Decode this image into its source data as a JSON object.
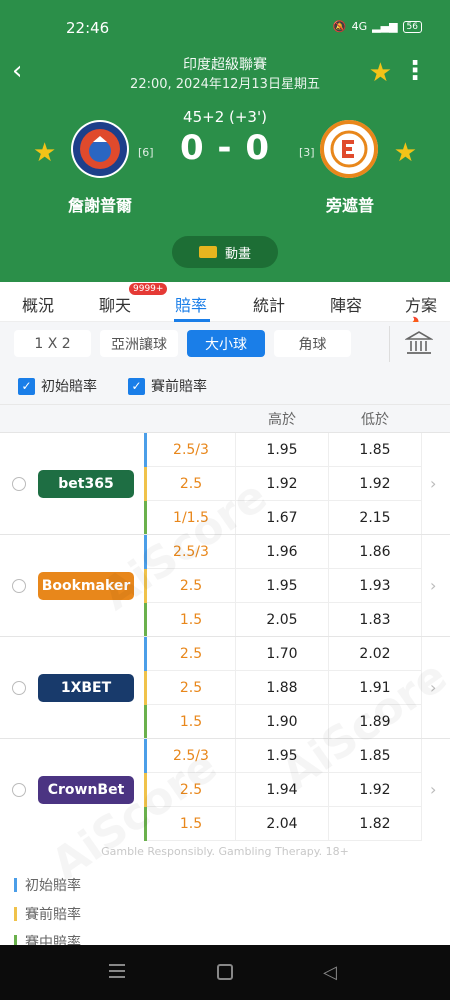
{
  "status": {
    "time": "22:46",
    "battery": "56",
    "network": "4G"
  },
  "header": {
    "league": "印度超級聯賽",
    "datetime": "22:00, 2024年12月13日星期五",
    "match_time": "45+2  (+3')",
    "score": "0 - 0",
    "home": {
      "name": "詹謝普爾",
      "rank": "[6]"
    },
    "away": {
      "name": "旁遮普",
      "rank": "[3]"
    },
    "animation_label": "動畫"
  },
  "tabs": [
    "概況",
    "聊天",
    "賠率",
    "統計",
    "陣容",
    "方案"
  ],
  "chat_badge": "9999+",
  "markets": [
    "1 X 2",
    "亞洲讓球",
    "大小球",
    "角球"
  ],
  "checks": {
    "opening": "初始賠率",
    "pregame": "賽前賠率"
  },
  "table_headers": {
    "over": "高於",
    "under": "低於"
  },
  "bookmakers": [
    {
      "name": "bet365",
      "color": "#1e6e43",
      "rows": [
        {
          "line": "2.5/3",
          "over": "1.95",
          "under": "1.85"
        },
        {
          "line": "2.5",
          "over": "1.92",
          "under": "1.92"
        },
        {
          "line": "1/1.5",
          "over": "1.67",
          "under": "2.15"
        }
      ]
    },
    {
      "name": "Bookmaker",
      "color": "#e8871b",
      "rows": [
        {
          "line": "2.5/3",
          "over": "1.96",
          "under": "1.86"
        },
        {
          "line": "2.5",
          "over": "1.95",
          "under": "1.93"
        },
        {
          "line": "1.5",
          "over": "2.05",
          "under": "1.83"
        }
      ]
    },
    {
      "name": "1XBET",
      "color": "#183a6b",
      "rows": [
        {
          "line": "2.5",
          "over": "1.70",
          "under": "2.02"
        },
        {
          "line": "2.5",
          "over": "1.88",
          "under": "1.91"
        },
        {
          "line": "1.5",
          "over": "1.90",
          "under": "1.89"
        }
      ]
    },
    {
      "name": "CrownBet",
      "color": "#4b3482",
      "rows": [
        {
          "line": "2.5/3",
          "over": "1.95",
          "under": "1.85"
        },
        {
          "line": "2.5",
          "over": "1.94",
          "under": "1.92"
        },
        {
          "line": "1.5",
          "over": "2.04",
          "under": "1.82"
        }
      ]
    }
  ],
  "row_colors": [
    "#4b9ee8",
    "#f0c24a",
    "#6ab04c"
  ],
  "gamble_note": "Gamble Responsibly. Gambling Therapy. 18+",
  "legend": [
    "初始賠率",
    "賽前賠率",
    "賽中賠率"
  ],
  "watermark": "AiScore"
}
